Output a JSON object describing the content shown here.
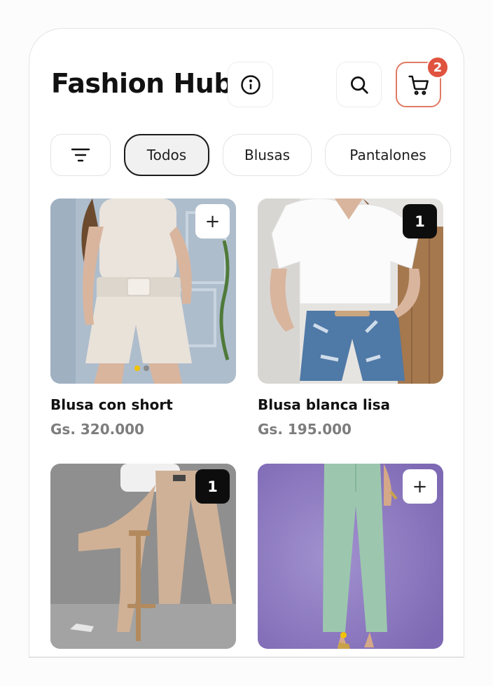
{
  "header": {
    "title": "Fashion Hub"
  },
  "cart": {
    "count": "2"
  },
  "filters": [
    "Todos",
    "Blusas",
    "Pantalones"
  ],
  "products": [
    {
      "name": "Blusa con short",
      "price": "Gs. 320.000",
      "action": "+",
      "image_slides": 2,
      "active_slide": 1
    },
    {
      "name": "Blusa blanca lisa",
      "price": "Gs. 195.000",
      "in_cart_qty": "1"
    },
    {
      "name": "",
      "price": "",
      "in_cart_qty": "1"
    },
    {
      "name": "",
      "price": "",
      "action": "+",
      "image_slides": 1,
      "active_slide": 1
    }
  ],
  "colors": {
    "accent": "#e0533f",
    "cart_border": "#e07a63",
    "slide_active": "#f2c200",
    "price": "#7d7d7d"
  }
}
